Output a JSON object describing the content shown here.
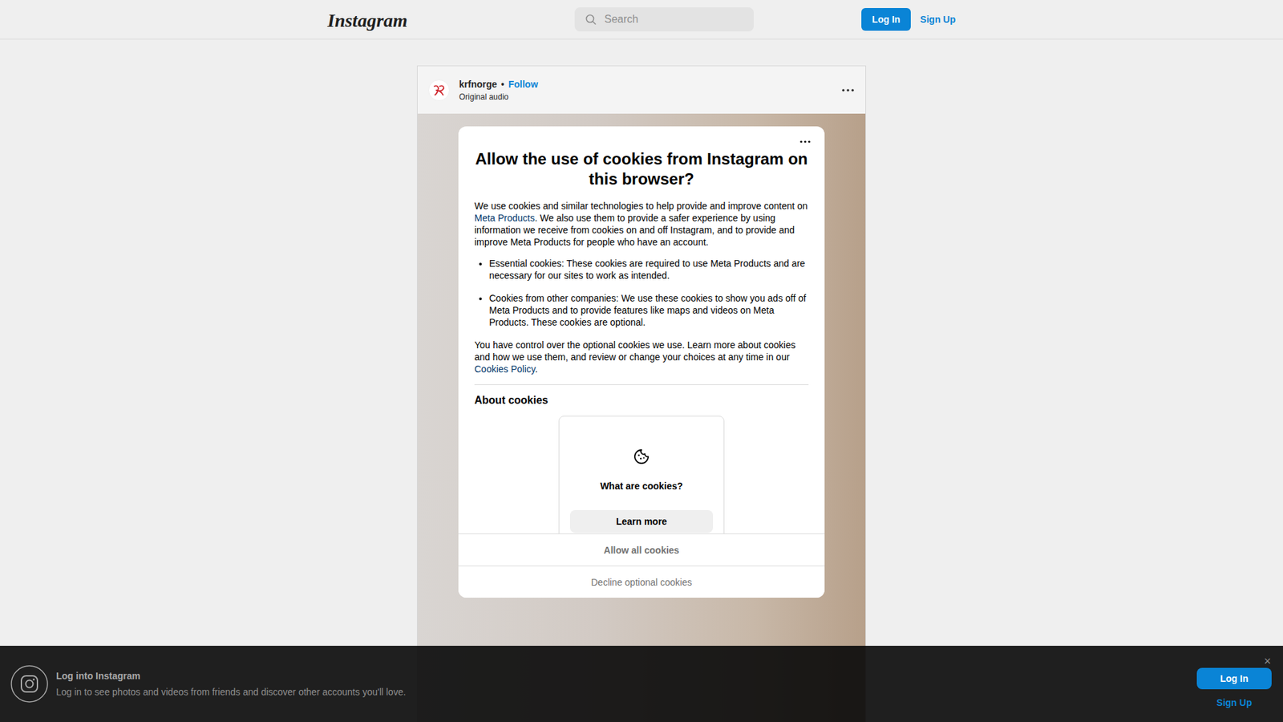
{
  "nav": {
    "logo": "Instagram",
    "search_placeholder": "Search",
    "login": "Log In",
    "signup": "Sign Up"
  },
  "post": {
    "username": "krfnorge",
    "separator": "•",
    "follow": "Follow",
    "audio": "Original audio"
  },
  "cookie_dialog": {
    "title": "Allow the use of cookies from Instagram on this browser?",
    "intro": [
      {
        "text": "We use cookies and similar technologies to help provide and improve content on ",
        "link": false
      },
      {
        "text": "Meta Products",
        "link": true
      },
      {
        "text": ". We also use them to provide a safer experience by using information we receive from cookies on and off Instagram, and to provide and improve Meta Products for people who have an account.",
        "link": false
      }
    ],
    "bullets": [
      "Essential cookies: These cookies are required to use Meta Products and are necessary for our sites to work as intended.",
      "Cookies from other companies: We use these cookies to show you ads off of Meta Products and to provide features like maps and videos on Meta Products. These cookies are optional."
    ],
    "control": [
      {
        "text": "You have control over the optional cookies we use. Learn more about cookies and how we use them, and review or change your choices at any time in our ",
        "link": false
      },
      {
        "text": "Cookies Policy",
        "link": true
      },
      {
        "text": ".",
        "link": false
      }
    ],
    "section_title": "About cookies",
    "card": {
      "title": "What are cookies?",
      "button": "Learn more"
    },
    "buttons": [
      {
        "label": "Allow all cookies",
        "kind": "primary",
        "disabled": true
      },
      {
        "label": "Decline optional cookies",
        "kind": "secondary",
        "disabled": true
      }
    ]
  },
  "banner": {
    "title": "Log into Instagram",
    "text": "Log in to see photos and videos from friends and discover other accounts you'll love.",
    "login": "Log In",
    "signup": "Sign Up",
    "close": "×"
  }
}
